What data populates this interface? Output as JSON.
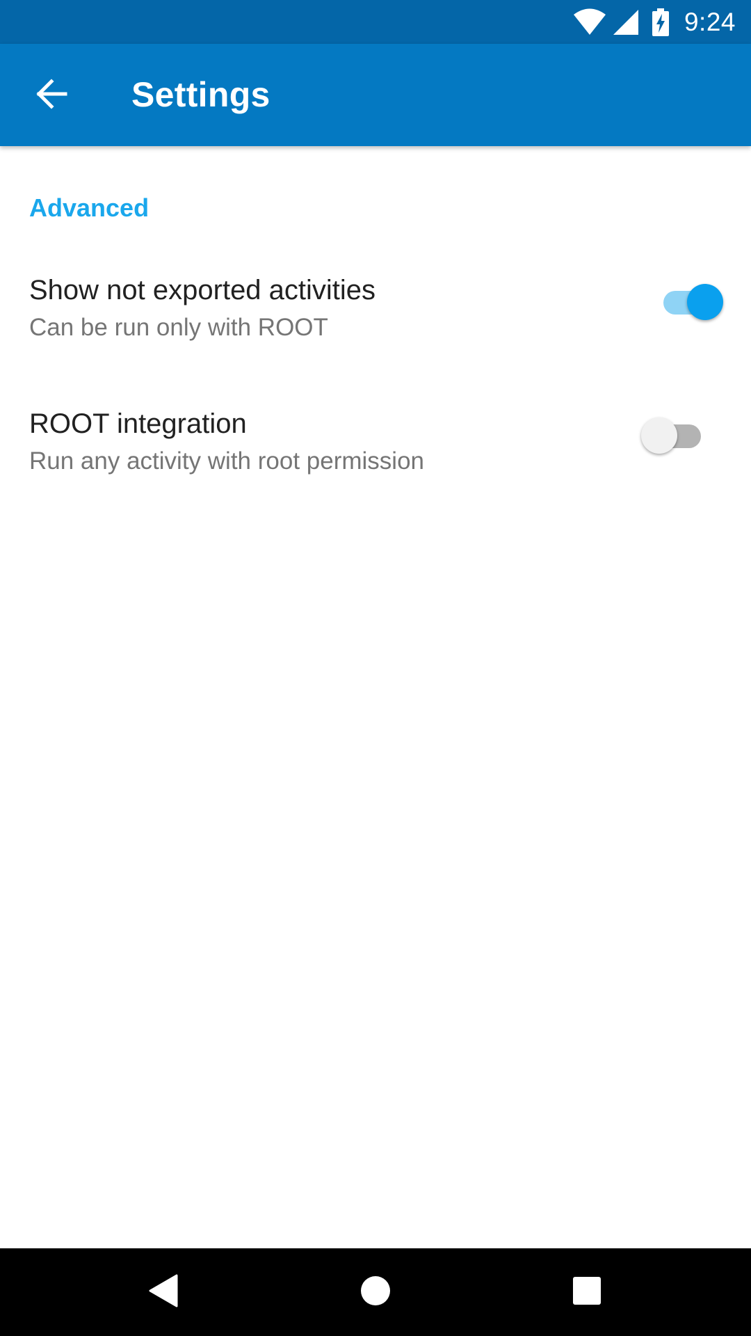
{
  "status_bar": {
    "time": "9:24",
    "icons": [
      "wifi-icon",
      "signal-icon",
      "battery-charging-icon"
    ]
  },
  "app_bar": {
    "back_icon": "arrow-left-icon",
    "title": "Settings"
  },
  "settings": {
    "section_header": "Advanced",
    "items": [
      {
        "title": "Show not exported activities",
        "summary": "Can be run only with ROOT",
        "enabled": true
      },
      {
        "title": "ROOT integration",
        "summary": "Run any activity with root permission",
        "enabled": false
      }
    ]
  },
  "nav_bar": {
    "icons": [
      "nav-back-icon",
      "nav-home-icon",
      "nav-recents-icon"
    ]
  },
  "colors": {
    "status_bar": "#0466a8",
    "app_bar": "#0479c2",
    "accent": "#1aa7ec",
    "switch_on_thumb": "#0aa0ee",
    "switch_on_track": "#8fd3f5"
  }
}
